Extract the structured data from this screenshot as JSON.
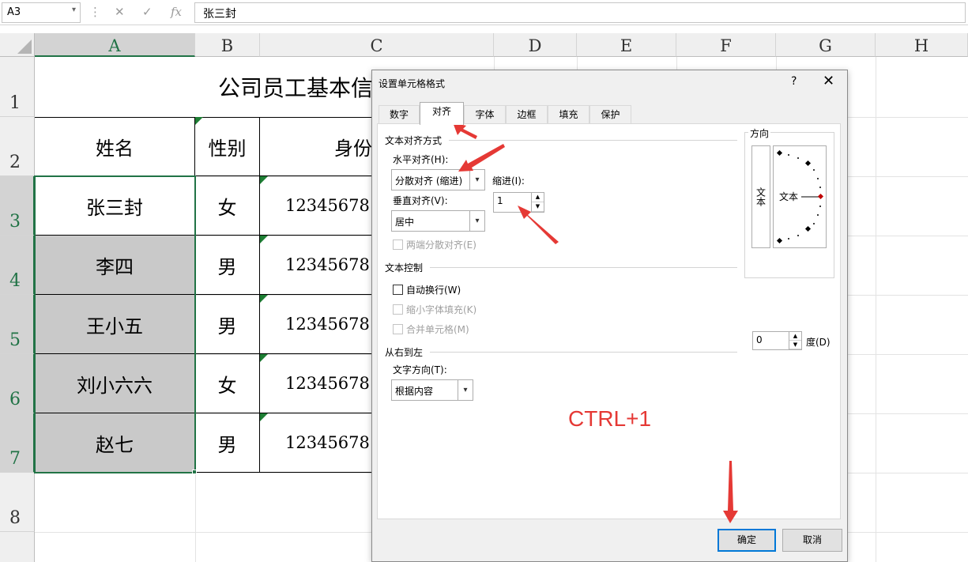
{
  "formula_bar": {
    "name_box": "A3",
    "name_box_arrow": "▾",
    "menu_dots": "⋮",
    "cancel_icon": "✕",
    "enter_icon": "✓",
    "function_icon": "fx",
    "content": "张三封"
  },
  "columns": [
    "A",
    "B",
    "C",
    "D",
    "E",
    "F",
    "G",
    "H"
  ],
  "rows": [
    "1",
    "2",
    "3",
    "4",
    "5",
    "6",
    "7",
    "8"
  ],
  "sheet": {
    "title": "公司员工基本信",
    "header": {
      "name": "姓名",
      "gender": "性别",
      "id": "身份"
    },
    "records": [
      {
        "name": "张三封",
        "gender": "女",
        "id": "12345678"
      },
      {
        "name": "李四",
        "gender": "男",
        "id": "12345678"
      },
      {
        "name": "王小五",
        "gender": "男",
        "id": "12345678"
      },
      {
        "name": "刘小六六",
        "gender": "女",
        "id": "12345678"
      },
      {
        "name": "赵七",
        "gender": "男",
        "id": "12345678"
      }
    ]
  },
  "dialog": {
    "title": "设置单元格格式",
    "help": "?",
    "close": "✕",
    "tabs": [
      "数字",
      "对齐",
      "字体",
      "边框",
      "填充",
      "保护"
    ],
    "active_tab": "对齐",
    "text_align_section": "文本对齐方式",
    "horizontal_label": "水平对齐(H):",
    "horizontal_value": "分散对齐 (缩进)",
    "indent_label": "缩进(I):",
    "indent_value": "1",
    "vertical_label": "垂直对齐(V):",
    "vertical_value": "居中",
    "justify_distributed": "两端分散对齐(E)",
    "text_control_section": "文本控制",
    "wrap_text": "自动换行(W)",
    "shrink_to_fit": "缩小字体填充(K)",
    "merge_cells": "合并单元格(M)",
    "rtl_section": "从右到左",
    "text_direction_label": "文字方向(T):",
    "text_direction_value": "根据内容",
    "orientation_section": "方向",
    "orientation_vertical_text": "文本",
    "orientation_dial_text": "文本",
    "degrees_value": "0",
    "degrees_label": "度(D)",
    "ok": "确定",
    "cancel": "取消"
  },
  "annotation": {
    "shortcut": "CTRL+1",
    "color": "#e53935"
  },
  "colors": {
    "excel_green": "#217346",
    "selection_gray": "#c9c9c9",
    "accent_blue": "#0078d7"
  }
}
